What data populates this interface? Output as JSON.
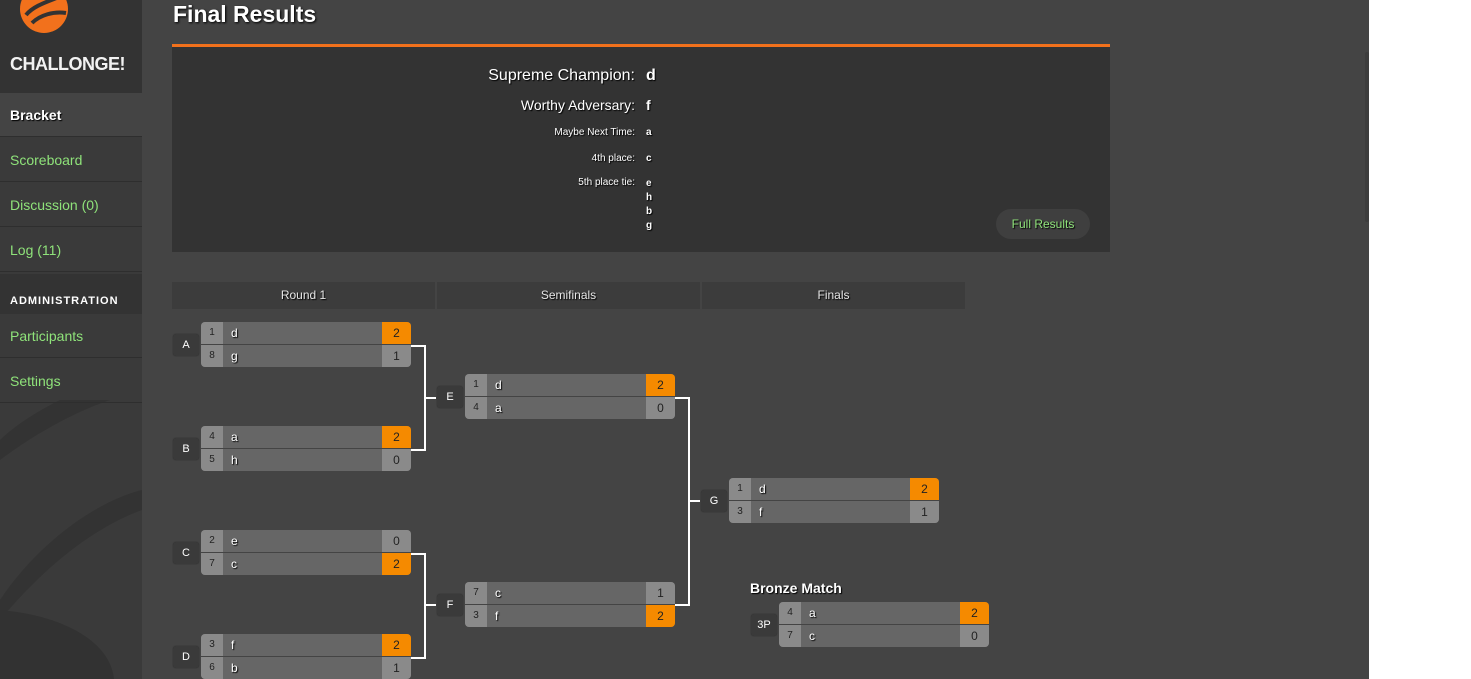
{
  "brand": {
    "name": "CHALLONGE!",
    "logo_icon": "challonge-ball-icon",
    "accent": "#f2711c",
    "win_color": "#f58a00",
    "link_color": "#8fe37a"
  },
  "sidebar": {
    "items": [
      {
        "label": "Bracket",
        "active": true
      },
      {
        "label": "Scoreboard"
      },
      {
        "label": "Discussion (0)"
      },
      {
        "label": "Log (11)"
      }
    ],
    "admin_header": "ADMINISTRATION",
    "admin_items": [
      {
        "label": "Participants"
      },
      {
        "label": "Settings"
      }
    ]
  },
  "page_title": "Final Results",
  "results": {
    "rows": [
      {
        "label": "Supreme Champion:",
        "values": [
          "d"
        ]
      },
      {
        "label": "Worthy Adversary:",
        "values": [
          "f"
        ]
      },
      {
        "label": "Maybe Next Time:",
        "values": [
          "a"
        ]
      },
      {
        "label": "4th place:",
        "values": [
          "c"
        ]
      },
      {
        "label": "5th place tie:",
        "values": [
          "e",
          "h",
          "b",
          "g"
        ]
      }
    ],
    "full_results_label": "Full Results"
  },
  "bracket": {
    "rounds": [
      "Round 1",
      "Semifinals",
      "Finals"
    ],
    "matches": [
      {
        "id": "A",
        "p1": {
          "seed": "1",
          "name": "d",
          "score": "2",
          "win": true
        },
        "p2": {
          "seed": "8",
          "name": "g",
          "score": "1",
          "win": false
        }
      },
      {
        "id": "B",
        "p1": {
          "seed": "4",
          "name": "a",
          "score": "2",
          "win": true
        },
        "p2": {
          "seed": "5",
          "name": "h",
          "score": "0",
          "win": false
        }
      },
      {
        "id": "C",
        "p1": {
          "seed": "2",
          "name": "e",
          "score": "0",
          "win": false
        },
        "p2": {
          "seed": "7",
          "name": "c",
          "score": "2",
          "win": true
        }
      },
      {
        "id": "D",
        "p1": {
          "seed": "3",
          "name": "f",
          "score": "2",
          "win": true
        },
        "p2": {
          "seed": "6",
          "name": "b",
          "score": "1",
          "win": false
        }
      },
      {
        "id": "E",
        "p1": {
          "seed": "1",
          "name": "d",
          "score": "2",
          "win": true
        },
        "p2": {
          "seed": "4",
          "name": "a",
          "score": "0",
          "win": false
        }
      },
      {
        "id": "F",
        "p1": {
          "seed": "7",
          "name": "c",
          "score": "1",
          "win": false
        },
        "p2": {
          "seed": "3",
          "name": "f",
          "score": "2",
          "win": true
        }
      },
      {
        "id": "G",
        "p1": {
          "seed": "1",
          "name": "d",
          "score": "2",
          "win": true
        },
        "p2": {
          "seed": "3",
          "name": "f",
          "score": "1",
          "win": false
        }
      },
      {
        "id": "3P",
        "p1": {
          "seed": "4",
          "name": "a",
          "score": "2",
          "win": true
        },
        "p2": {
          "seed": "7",
          "name": "c",
          "score": "0",
          "win": false
        }
      }
    ],
    "bronze_title": "Bronze Match"
  }
}
